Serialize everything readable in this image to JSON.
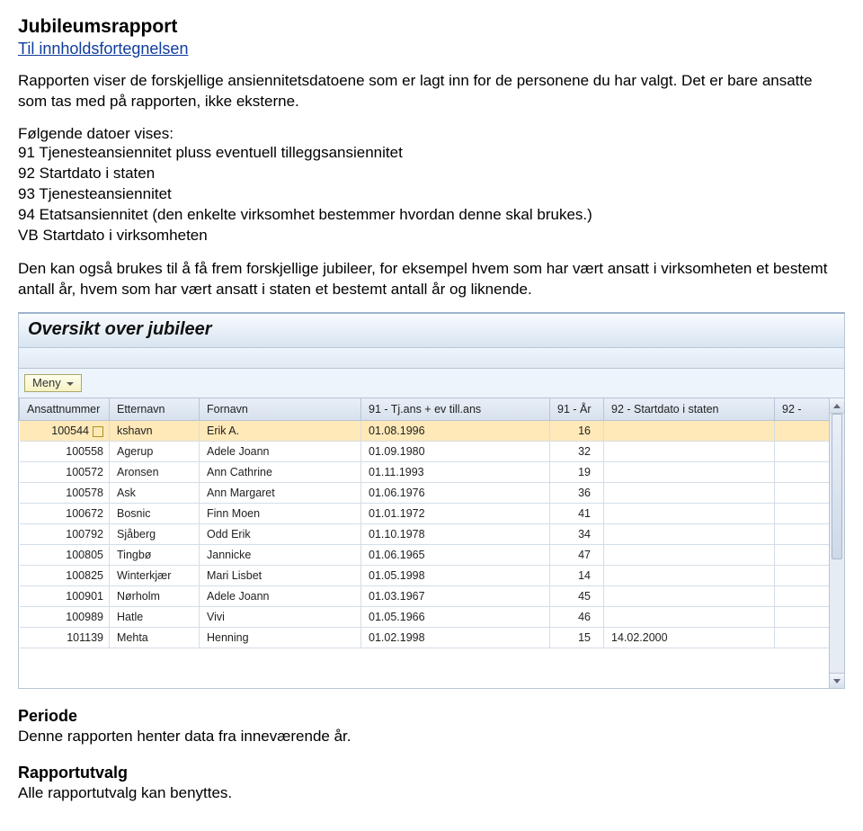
{
  "doc": {
    "title": "Jubileumsrapport",
    "toc_link": "Til innholdsfortegnelsen",
    "para1": "Rapporten viser de forskjellige ansiennitetsdatoene som er lagt inn for de personene du har valgt. Det er bare ansatte som tas med på rapporten, ikke eksterne.",
    "list_intro": "Følgende datoer vises:",
    "d91": "91 Tjenesteansiennitet pluss eventuell tilleggsansiennitet",
    "d92": "92 Startdato i staten",
    "d93": "93 Tjenesteansiennitet",
    "d94": "94 Etatsansiennitet (den enkelte virksomhet bestemmer hvordan denne skal brukes.)",
    "dvb": "VB Startdato i virksomheten",
    "para2": "Den kan også brukes til å få frem forskjellige jubileer, for eksempel hvem som har vært ansatt i virksomheten et bestemt antall år, hvem som har vært ansatt i staten et bestemt antall år og liknende.",
    "periode_h": "Periode",
    "periode_t": "Denne rapporten henter data fra inneværende år.",
    "utvalg_h": "Rapportutvalg",
    "utvalg_t": "Alle rapportutvalg kan benyttes."
  },
  "app": {
    "title": "Oversikt over jubileer",
    "meny_label": "Meny",
    "headers": {
      "ansatt": "Ansattnummer",
      "etternavn": "Etternavn",
      "fornavn": "Fornavn",
      "c91": "91 - Tj.ans + ev till.ans",
      "c91ar": "91 - År",
      "c92": "92 - Startdato i staten",
      "c92cut": "92 -"
    },
    "rows": [
      {
        "ansatt": "100544",
        "et": "kshavn",
        "fo": "Erik A.",
        "d": "01.08.1996",
        "ar": "16",
        "s": ""
      },
      {
        "ansatt": "100558",
        "et": "Agerup",
        "fo": "Adele Joann",
        "d": "01.09.1980",
        "ar": "32",
        "s": ""
      },
      {
        "ansatt": "100572",
        "et": "Aronsen",
        "fo": "Ann Cathrine",
        "d": "01.11.1993",
        "ar": "19",
        "s": ""
      },
      {
        "ansatt": "100578",
        "et": "Ask",
        "fo": "Ann Margaret",
        "d": "01.06.1976",
        "ar": "36",
        "s": ""
      },
      {
        "ansatt": "100672",
        "et": "Bosnic",
        "fo": "Finn Moen",
        "d": "01.01.1972",
        "ar": "41",
        "s": ""
      },
      {
        "ansatt": "100792",
        "et": "Sjåberg",
        "fo": "Odd Erik",
        "d": "01.10.1978",
        "ar": "34",
        "s": ""
      },
      {
        "ansatt": "100805",
        "et": "Tingbø",
        "fo": "Jannicke",
        "d": "01.06.1965",
        "ar": "47",
        "s": ""
      },
      {
        "ansatt": "100825",
        "et": "Winterkjær",
        "fo": "Mari Lisbet",
        "d": "01.05.1998",
        "ar": "14",
        "s": ""
      },
      {
        "ansatt": "100901",
        "et": "Nørholm",
        "fo": "Adele Joann",
        "d": "01.03.1967",
        "ar": "45",
        "s": ""
      },
      {
        "ansatt": "100989",
        "et": "Hatle",
        "fo": "Vivi",
        "d": "01.05.1966",
        "ar": "46",
        "s": ""
      },
      {
        "ansatt": "101139",
        "et": "Mehta",
        "fo": "Henning",
        "d": "01.02.1998",
        "ar": "15",
        "s": "14.02.2000"
      }
    ]
  }
}
